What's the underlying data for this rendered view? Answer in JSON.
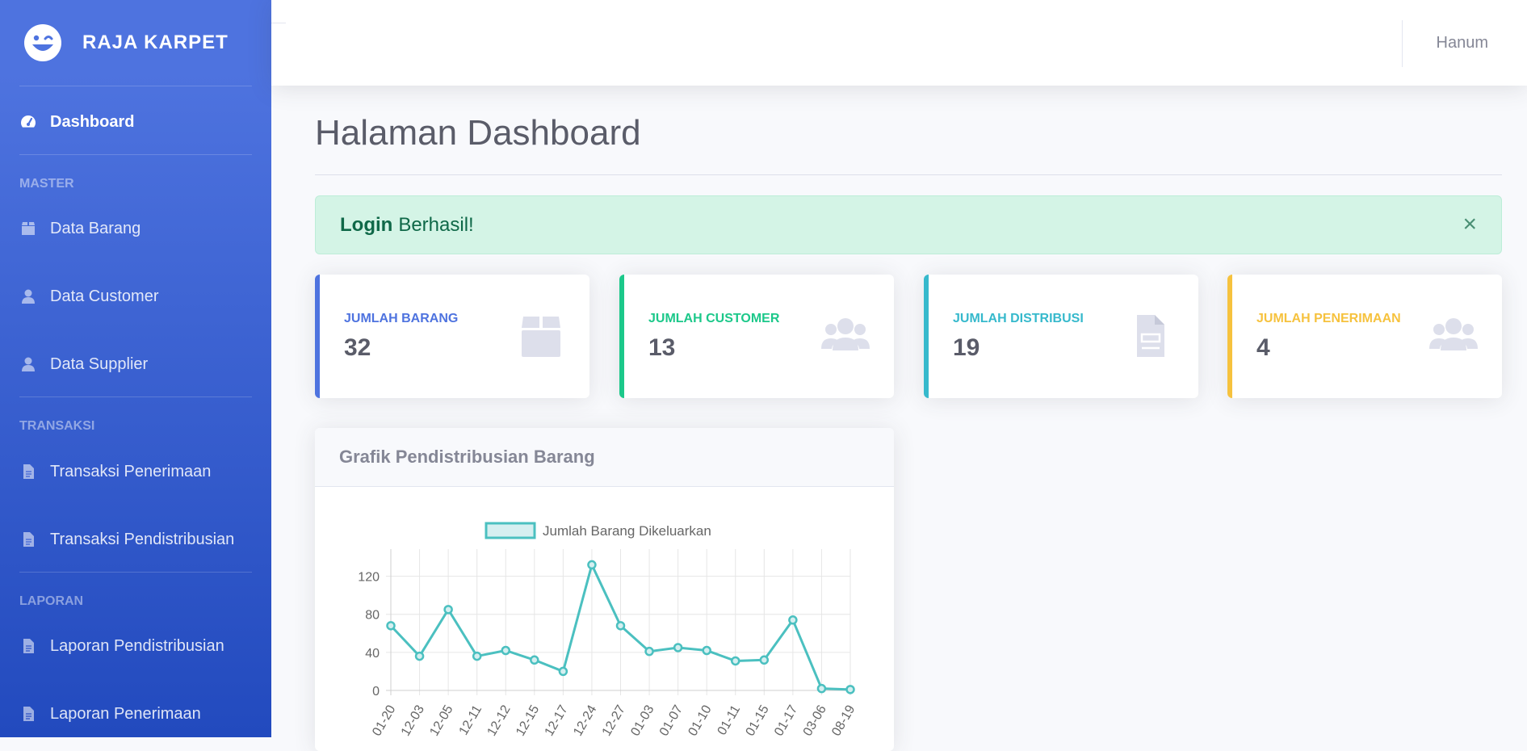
{
  "brand": {
    "name": "RAJA KARPET",
    "logo_icon": "laugh-wink-icon"
  },
  "sidebar": {
    "dashboard": {
      "label": "Dashboard",
      "icon": "tachometer-icon"
    },
    "headings": [
      "MASTER",
      "TRANSAKSI",
      "LAPORAN"
    ],
    "master": [
      {
        "label": "Data Barang",
        "icon": "box-icon"
      },
      {
        "label": "Data Customer",
        "icon": "user-icon"
      },
      {
        "label": "Data Supplier",
        "icon": "user-icon"
      }
    ],
    "transaksi": [
      {
        "label": "Transaksi Penerimaan",
        "icon": "file-icon"
      },
      {
        "label": "Transaksi Pendistribusian",
        "icon": "file-icon"
      }
    ],
    "laporan": [
      {
        "label": "Laporan Pendistribusian",
        "icon": "file-icon"
      },
      {
        "label": "Laporan Penerimaan",
        "icon": "file-icon"
      }
    ]
  },
  "topbar": {
    "user": "Hanum"
  },
  "page": {
    "title": "Halaman Dashboard"
  },
  "alert": {
    "bold": "Login",
    "text": "Berhasil!",
    "close": "×"
  },
  "cards": [
    {
      "label": "JUMLAH BARANG",
      "value": "32",
      "color": "#4e73df",
      "icon": "box-icon"
    },
    {
      "label": "JUMLAH CUSTOMER",
      "value": "13",
      "color": "#1cc88a",
      "icon": "users-icon"
    },
    {
      "label": "JUMLAH DISTRIBUSI",
      "value": "19",
      "color": "#36b9cc",
      "icon": "file-invoice-icon"
    },
    {
      "label": "JUMLAH PENERIMAAN",
      "value": "4",
      "color": "#f6c23e",
      "icon": "users-icon"
    }
  ],
  "chart_card": {
    "title": "Grafik Pendistribusian Barang"
  },
  "chart_data": {
    "type": "line",
    "title": "",
    "xlabel": "",
    "ylabel": "",
    "categories": [
      "01-20",
      "12-03",
      "12-05",
      "12-11",
      "12-12",
      "12-15",
      "12-17",
      "12-24",
      "12-27",
      "01-03",
      "01-07",
      "01-10",
      "01-11",
      "01-15",
      "01-17",
      "03-06",
      "08-19"
    ],
    "series": [
      {
        "name": "Jumlah Barang Dikeluarkan",
        "values": [
          68,
          36,
          85,
          36,
          42,
          32,
          20,
          132,
          68,
          41,
          45,
          42,
          31,
          32,
          74,
          2,
          1
        ]
      }
    ],
    "yticks": [
      0,
      40,
      80,
      120
    ],
    "ylim": [
      0,
      140
    ],
    "grid": true,
    "legend": "top",
    "color": "#4bc0c0"
  }
}
